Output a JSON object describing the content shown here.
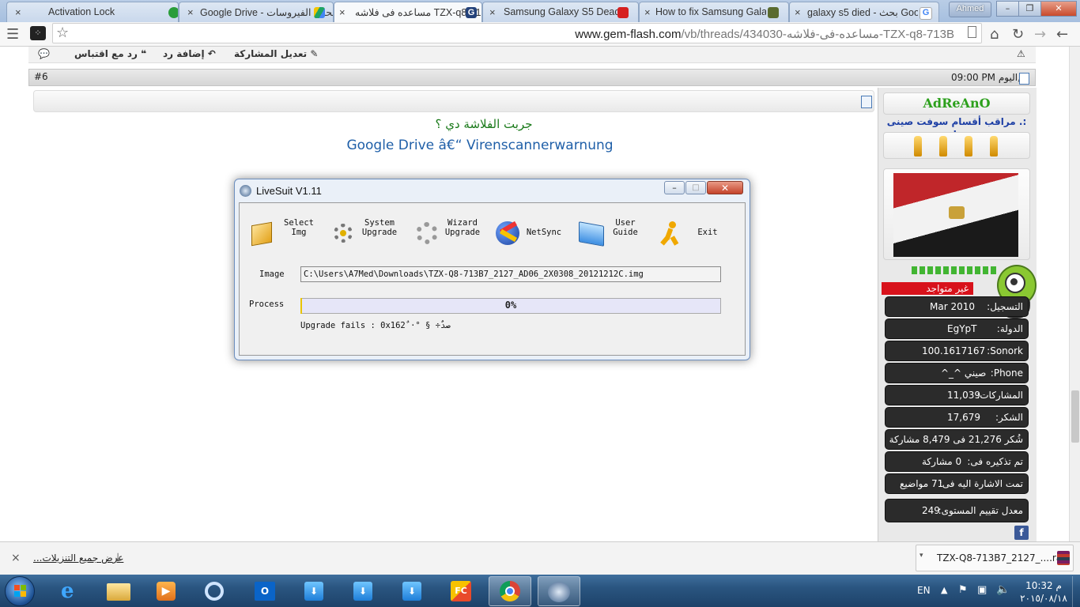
{
  "browser": {
    "tabs": [
      {
        "title": "Activation Lock",
        "close": "×"
      },
      {
        "title": "Google Drive - فحص الفيروسات",
        "close": "×"
      },
      {
        "title": "مساعده فى فلاشه TZX-q8-713B",
        "close": "×"
      },
      {
        "title": "Samsung Galaxy S5 Dead",
        "close": "×"
      },
      {
        "title": "How to fix Samsung Galax",
        "close": "×"
      },
      {
        "title": "galaxy s5 died - بحث Goog",
        "close": "×"
      }
    ],
    "user": "Ahmed",
    "window_controls": {
      "minimize": "–",
      "maximize": "❐",
      "close": "✕"
    },
    "url_host": "www.gem-flash.com",
    "url_path": "/vb/threads/434030-مساعده-فى-فلاشه-TZX-q8-713B"
  },
  "post": {
    "actions": {
      "edit": "تعديل المشاركة",
      "reply": "إضافة رد",
      "quote": "رد مع اقتباس"
    },
    "number": "#6",
    "date_label": "اليوم,",
    "time": "09:00 PM",
    "question": "جربت الفلاشة دي ؟",
    "link_text": "Google Drive â€“ Virenscannerwarnung"
  },
  "user_card": {
    "username": "AdReAnO",
    "title": ":. مراقب أقسام سوفت صينى .:",
    "status": "غير متواجد",
    "stats": [
      {
        "label": "التسجيل:",
        "value": "Mar 2010"
      },
      {
        "label": "الدولة:",
        "value": "EgYpT"
      },
      {
        "label": "Sonork:",
        "value": "100.1617167"
      },
      {
        "label": "Phone:",
        "value": "صيني ^_^"
      },
      {
        "label": "المشاركات:",
        "value": "11,039"
      },
      {
        "label": "الشكر:",
        "value": "17,679"
      },
      {
        "label": "شُكر 21,276 فى 8,479 مشاركة",
        "value": ""
      },
      {
        "label": "تم تذكيره فى:",
        "value": "0 مشاركة"
      },
      {
        "label": "تمت الاشارة اليه فى:",
        "value": "71 مواضيع"
      },
      {
        "label": "معدل تقييم المستوى:",
        "value": "249"
      }
    ]
  },
  "livesuit": {
    "title": "LiveSuit V1.11",
    "buttons": [
      {
        "line1": "Select",
        "line2": "Img"
      },
      {
        "line1": "System",
        "line2": "Upgrade"
      },
      {
        "line1": "Wizard",
        "line2": "Upgrade"
      },
      {
        "line1": "NetSync",
        "line2": ""
      },
      {
        "line1": "User",
        "line2": "Guide"
      },
      {
        "line1": "Exit",
        "line2": ""
      }
    ],
    "image_label": "Image",
    "image_path": "C:\\Users\\A7Med\\Downloads\\TZX-Q8-713B7_2127_AD06_2X0308_20121212C.img",
    "process_label": "Process",
    "progress_text": "0%",
    "progress": 0,
    "status": "Upgrade fails : 0x162 ٌ·° § ÷صدٌ"
  },
  "downloads": {
    "show_all": "عرض جميع التنزيلات...",
    "file": "TZX-Q8-713B7_2127_....rar",
    "close": "×"
  },
  "taskbar": {
    "lang": "EN",
    "time": "10:32 م",
    "date": "٢٠١٥/٠٨/١٨"
  }
}
